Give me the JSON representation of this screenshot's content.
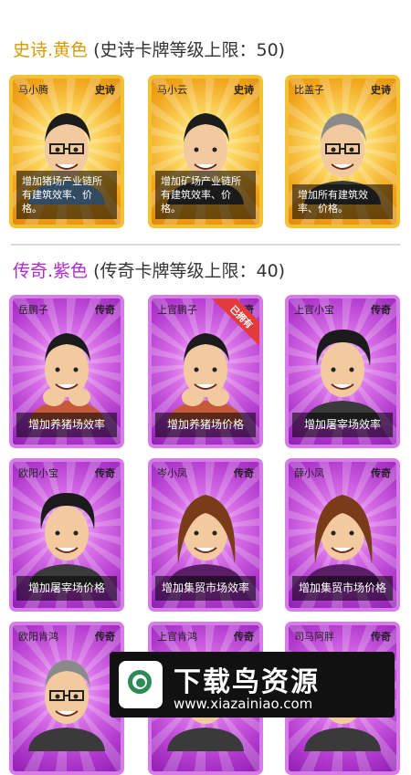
{
  "sections": {
    "epic": {
      "name": "史诗.黄色",
      "limit": " (史诗卡牌等级上限：50)",
      "color": "#d89a06"
    },
    "legend": {
      "name": "传奇.紫色",
      "limit": " (传奇卡牌等级上限：40)",
      "color": "#b02ad0"
    }
  },
  "epic_cards": [
    {
      "name": "马小腾",
      "tier": "史诗",
      "desc": "增加猪场产业链所有建筑效率、价格。",
      "portrait": "glasses-man-icon"
    },
    {
      "name": "马小云",
      "tier": "史诗",
      "desc": "增加矿场产业链所有建筑效率、价格。",
      "portrait": "suit-man-icon"
    },
    {
      "name": "比盖子",
      "tier": "史诗",
      "desc": "增加所有建筑效率、价格。",
      "portrait": "gray-glasses-man-icon"
    }
  ],
  "legend_cards": [
    {
      "name": "岳鹏子",
      "tier": "传奇",
      "desc": "增加养猪场效率",
      "portrait": "hands-chin-man-icon"
    },
    {
      "name": "上官鹏子",
      "tier": "传奇",
      "desc": "增加养猪场价格",
      "portrait": "hands-chin-man-icon",
      "ribbon": "已拥有"
    },
    {
      "name": "上官小宝",
      "tier": "传奇",
      "desc": "增加屠宰场效率",
      "portrait": "curly-hair-man-icon"
    },
    {
      "name": "欧阳小宝",
      "tier": "传奇",
      "desc": "增加屠宰场价格",
      "portrait": "curly-hair-man-icon"
    },
    {
      "name": "岑小凤",
      "tier": "传奇",
      "desc": "增加集贸市场效率",
      "portrait": "woman-icon"
    },
    {
      "name": "薛小凤",
      "tier": "传奇",
      "desc": "增加集贸市场价格",
      "portrait": "woman-icon"
    },
    {
      "name": "欧阳肯鸿",
      "tier": "传奇",
      "desc": "",
      "portrait": "white-hair-man-icon"
    },
    {
      "name": "上官肯鸿",
      "tier": "传奇",
      "desc": "",
      "portrait": "white-hair-man-icon"
    },
    {
      "name": "司马阿胖",
      "tier": "传奇",
      "desc": "",
      "portrait": "dark-hair-man-icon"
    }
  ],
  "watermark": {
    "title": "下载鸟资源",
    "url": "www.xiazainiao.com"
  }
}
